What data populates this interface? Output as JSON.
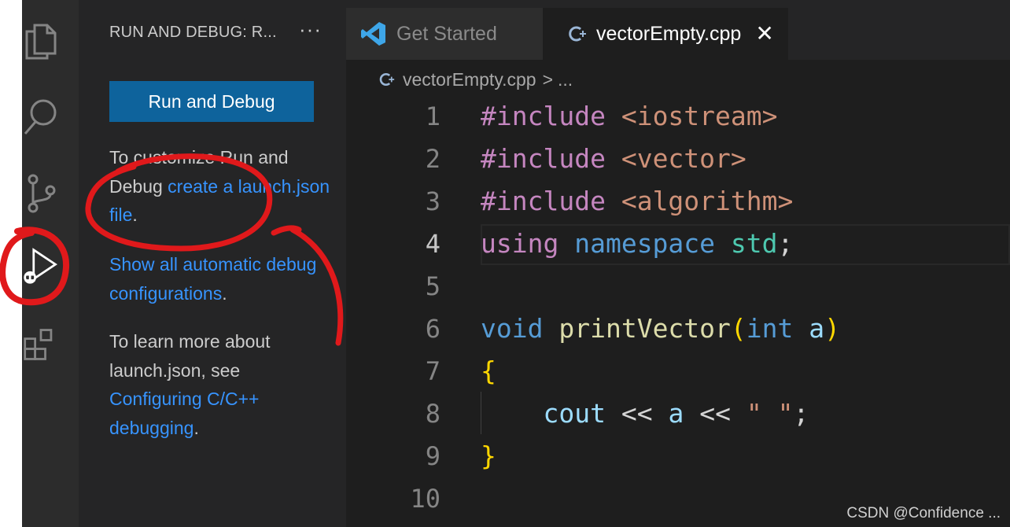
{
  "activity_bar": {
    "icons": [
      "explorer-icon",
      "search-icon",
      "source-control-icon",
      "run-debug-icon",
      "extensions-icon"
    ]
  },
  "sidebar": {
    "title": "RUN AND DEBUG: R...",
    "more": "···",
    "run_button": "Run and Debug",
    "para1_text1": "To customize Run and Debug ",
    "para1_link": "create a launch.json file",
    "para1_end": ".",
    "para2_link": "Show all automatic debug configurations",
    "para2_end": ".",
    "para3_text": "To learn more about launch.json, see ",
    "para3_link": "Configuring C/C++ debugging",
    "para3_end": "."
  },
  "tabs": [
    {
      "label": "Get Started",
      "active": false
    },
    {
      "label": "vectorEmpty.cpp",
      "active": true,
      "close": "✕"
    }
  ],
  "breadcrumb": {
    "file": "vectorEmpty.cpp",
    "sep": ">",
    "more": "..."
  },
  "editor": {
    "line_numbers": [
      "1",
      "2",
      "3",
      "4",
      "5",
      "6",
      "7",
      "8",
      "9",
      "10"
    ],
    "active_line": "4",
    "code": {
      "l1_a": "#include",
      "l1_b": "<iostream>",
      "l2_a": "#include",
      "l2_b": "<vector>",
      "l3_a": "#include",
      "l3_b": "<algorithm>",
      "l4_a": "using",
      "l4_b": "namespace",
      "l4_c": "std",
      "l4_d": ";",
      "l6_a": "void",
      "l6_b": "printVector",
      "l6_c": "(",
      "l6_d": "int",
      "l6_e": "a",
      "l6_f": ")",
      "l7": "{",
      "l8_a": "cout",
      "l8_b": "<<",
      "l8_c": "a",
      "l8_d": "<<",
      "l8_e": "\" \"",
      "l8_f": ";",
      "l9": "}"
    }
  },
  "watermark": "CSDN @Confidence ...",
  "colors": {
    "accent_button": "#0e639c",
    "link": "#3794ff",
    "annotation": "#e0191b"
  }
}
